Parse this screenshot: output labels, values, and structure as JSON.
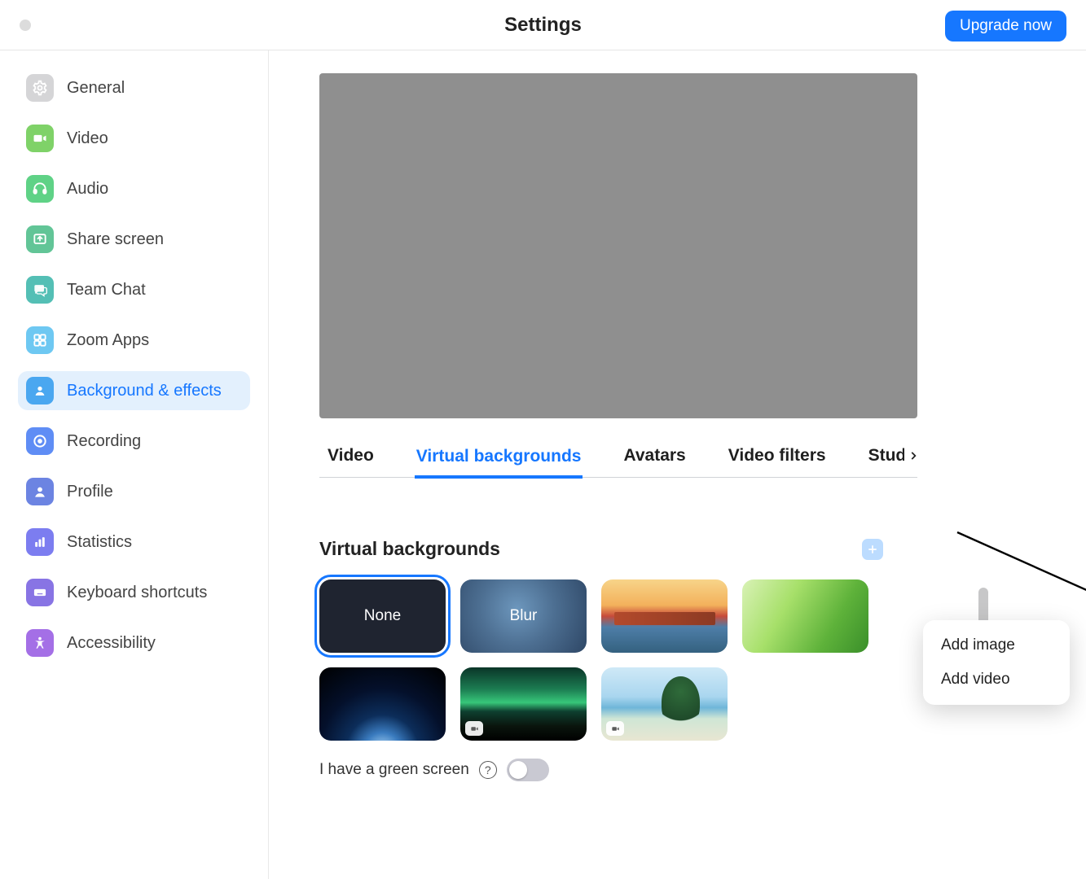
{
  "header": {
    "title": "Settings",
    "upgrade_label": "Upgrade now"
  },
  "sidebar": {
    "items": [
      {
        "label": "General",
        "icon": "gear",
        "bg": "#d5d5d7",
        "fg": "#ffffff"
      },
      {
        "label": "Video",
        "icon": "video",
        "bg": "#7fd268",
        "fg": "#ffffff"
      },
      {
        "label": "Audio",
        "icon": "headset",
        "bg": "#5fd286",
        "fg": "#ffffff"
      },
      {
        "label": "Share screen",
        "icon": "share",
        "bg": "#62c597",
        "fg": "#ffffff"
      },
      {
        "label": "Team Chat",
        "icon": "chat",
        "bg": "#54bfb5",
        "fg": "#ffffff"
      },
      {
        "label": "Zoom Apps",
        "icon": "apps",
        "bg": "#6ec8f2",
        "fg": "#ffffff"
      },
      {
        "label": "Background & effects",
        "icon": "person",
        "bg": "#4aa7f0",
        "fg": "#ffffff",
        "selected": true
      },
      {
        "label": "Recording",
        "icon": "record",
        "bg": "#5f8df5",
        "fg": "#ffffff"
      },
      {
        "label": "Profile",
        "icon": "profile",
        "bg": "#6c84e2",
        "fg": "#ffffff"
      },
      {
        "label": "Statistics",
        "icon": "stats",
        "bg": "#7c7df0",
        "fg": "#ffffff"
      },
      {
        "label": "Keyboard shortcuts",
        "icon": "keyboard",
        "bg": "#8874e4",
        "fg": "#ffffff"
      },
      {
        "label": "Accessibility",
        "icon": "a11y",
        "bg": "#a46fe6",
        "fg": "#ffffff"
      }
    ]
  },
  "tabs": {
    "items": [
      {
        "label": "Video"
      },
      {
        "label": "Virtual backgrounds",
        "active": true
      },
      {
        "label": "Avatars"
      },
      {
        "label": "Video filters"
      },
      {
        "label": "Studio"
      }
    ]
  },
  "section": {
    "title": "Virtual backgrounds",
    "thumbs": [
      {
        "label": "None",
        "kind": "none",
        "selected": true
      },
      {
        "label": "Blur",
        "kind": "blur"
      },
      {
        "label": "",
        "kind": "bridge"
      },
      {
        "label": "",
        "kind": "grass"
      },
      {
        "label": "",
        "kind": "earth",
        "video": false
      },
      {
        "label": "",
        "kind": "aurora",
        "video": true
      },
      {
        "label": "",
        "kind": "beach",
        "video": true
      }
    ],
    "greenscreen_label": "I have a green screen",
    "greenscreen_on": false
  },
  "popover": {
    "items": [
      {
        "label": "Add image"
      },
      {
        "label": "Add video"
      }
    ]
  }
}
